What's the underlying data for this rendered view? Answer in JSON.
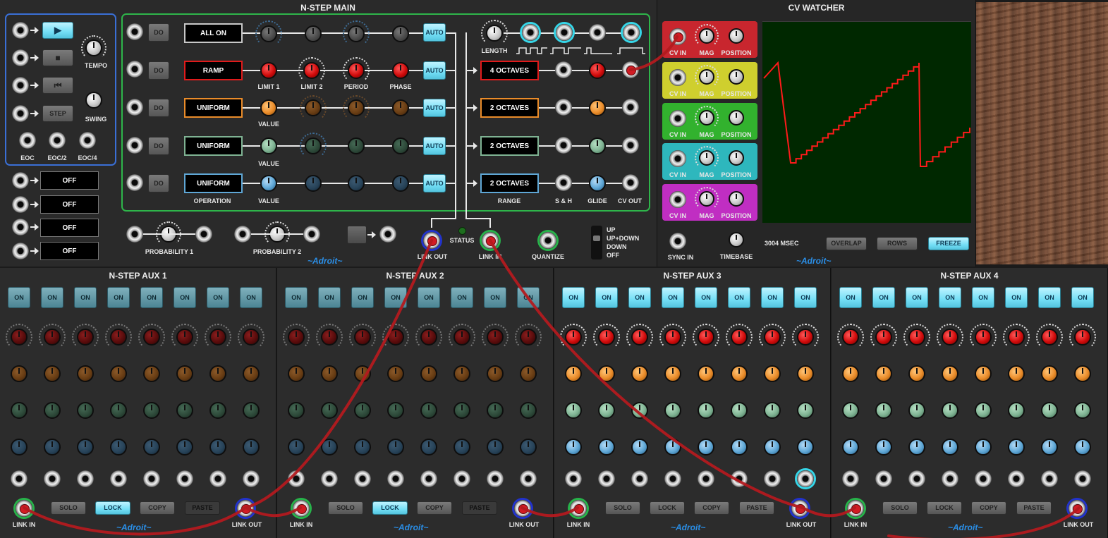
{
  "main": {
    "title": "N-STEP MAIN",
    "transport": {
      "buttons": [
        "play",
        "stop",
        "reset",
        "STEP"
      ],
      "tempo_label": "TEMPO",
      "swing_label": "SWING",
      "eoc_labels": [
        "EOC",
        "EOC/2",
        "EOC/4"
      ]
    },
    "off_buttons": [
      "OFF",
      "OFF",
      "OFF",
      "OFF"
    ],
    "do_label": "DO",
    "auto_label": "AUTO",
    "rows": [
      {
        "mode": "ALL ON",
        "color": "#c8c8c8",
        "labels": [
          "",
          "",
          "",
          ""
        ],
        "range": ""
      },
      {
        "mode": "RAMP",
        "color": "#e01b1b",
        "labels": [
          "LIMIT 1",
          "LIMIT 2",
          "PERIOD",
          "PHASE"
        ],
        "range": "4 OCTAVES"
      },
      {
        "mode": "UNIFORM",
        "color": "#ea8c2a",
        "labels": [
          "VALUE",
          "",
          "",
          ""
        ],
        "range": "2 OCTAVES"
      },
      {
        "mode": "UNIFORM",
        "color": "#7fb393",
        "labels": [
          "VALUE",
          "",
          "",
          ""
        ],
        "range": "2 OCTAVES"
      },
      {
        "mode": "UNIFORM",
        "color": "#5fa7d6",
        "labels": [
          "VALUE",
          "",
          "",
          ""
        ],
        "range": "2 OCTAVES"
      }
    ],
    "operation_label": "OPERATION",
    "length_label": "LENGTH",
    "range_label": "RANGE",
    "sh_label": "S & H",
    "glide_label": "GLIDE",
    "cvout_label": "CV OUT",
    "probability1_label": "PROBABILITY 1",
    "probability2_label": "PROBABILITY 2",
    "link_out_label": "LINK OUT",
    "status_label": "STATUS",
    "link_in_label": "LINK IN",
    "quantize_label": "QUANTIZE",
    "glide_modes": [
      "UP",
      "UP+DOWN",
      "DOWN",
      "OFF"
    ],
    "brand": "~Adroit~"
  },
  "watcher": {
    "title": "CV WATCHER",
    "rows": [
      {
        "color": "#c8262e",
        "cv_in": "CV IN",
        "mag": "MAG",
        "position": "POSITION"
      },
      {
        "color": "#cfcf2e",
        "cv_in": "CV IN",
        "mag": "MAG",
        "position": "POSITION"
      },
      {
        "color": "#32b22e",
        "cv_in": "CV IN",
        "mag": "MAG",
        "position": "POSITION"
      },
      {
        "color": "#2eb7bd",
        "cv_in": "CV IN",
        "mag": "MAG",
        "position": "POSITION"
      },
      {
        "color": "#c02ec2",
        "cv_in": "CV IN",
        "mag": "MAG",
        "position": "POSITION"
      }
    ],
    "sync_in_label": "SYNC IN",
    "timebase_label": "TIMEBASE",
    "msec": "3004 MSEC",
    "buttons": [
      "OVERLAP",
      "ROWS",
      "FREEZE"
    ],
    "brand": "~Adroit~"
  },
  "aux": [
    {
      "title": "N-STEP AUX 1",
      "on_labels": [
        "ON",
        "ON",
        "ON",
        "ON",
        "ON",
        "ON",
        "ON",
        "ON"
      ],
      "buttons": [
        "SOLO",
        "LOCK",
        "COPY",
        "PASTE"
      ],
      "link_in": "LINK IN",
      "link_out": "LINK OUT",
      "brand": "~Adroit~"
    },
    {
      "title": "N-STEP AUX 2",
      "on_labels": [
        "ON",
        "ON",
        "ON",
        "ON",
        "ON",
        "ON",
        "ON",
        "ON"
      ],
      "buttons": [
        "SOLO",
        "LOCK",
        "COPY",
        "PASTE"
      ],
      "link_in": "LINK IN",
      "link_out": "LINK OUT",
      "brand": "~Adroit~"
    },
    {
      "title": "N-STEP AUX 3",
      "on_labels": [
        "ON",
        "ON",
        "ON",
        "ON",
        "ON",
        "ON",
        "ON",
        "ON"
      ],
      "buttons": [
        "SOLO",
        "LOCK",
        "COPY",
        "PASTE"
      ],
      "link_in": "LINK IN",
      "link_out": "LINK OUT",
      "brand": "~Adroit~"
    },
    {
      "title": "N-STEP AUX 4",
      "on_labels": [
        "ON",
        "ON",
        "ON",
        "ON",
        "ON",
        "ON",
        "ON",
        "ON"
      ],
      "buttons": [
        "SOLO",
        "LOCK",
        "COPY",
        "PASTE"
      ],
      "link_in": "LINK IN",
      "link_out": "LINK OUT",
      "brand": "~Adroit~"
    }
  ]
}
